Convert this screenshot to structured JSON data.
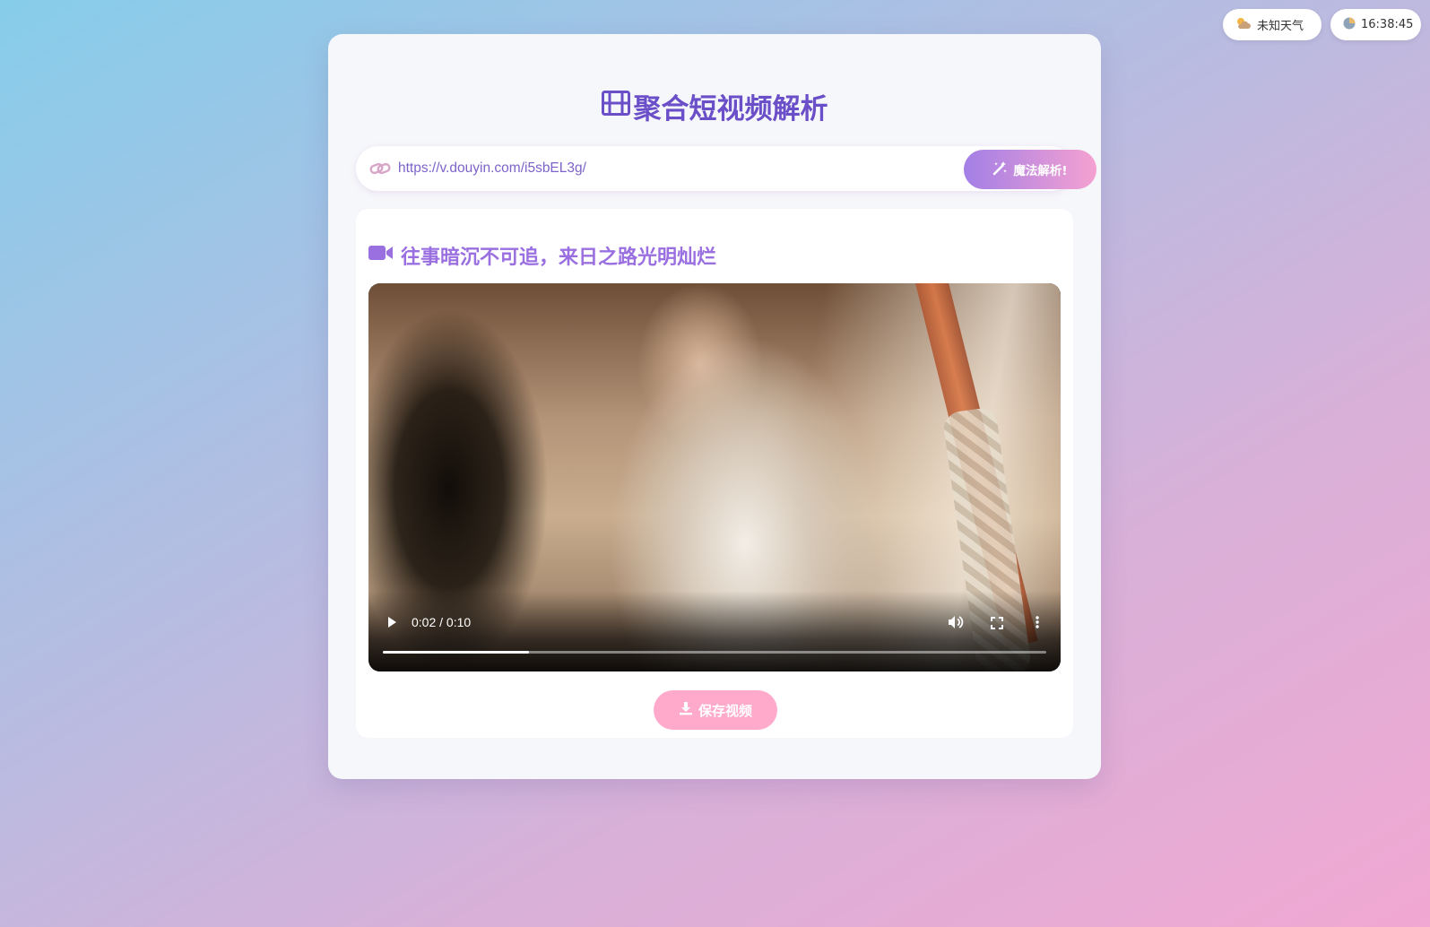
{
  "status": {
    "weather_icon": "partly-cloudy-icon",
    "weather_label": "未知天气",
    "clock_icon": "clock-icon",
    "time": "16:38:45"
  },
  "header": {
    "title_icon": "film-icon",
    "title": "聚合短视频解析"
  },
  "search": {
    "icon": "link-icon",
    "value": "https://v.douyin.com/i5sbEL3g/",
    "button_label": "魔法解析!"
  },
  "result": {
    "title_icon": "video-camera-icon",
    "title": "往事暗沉不可追，来日之路光明灿烂",
    "player": {
      "current_time": "0:02",
      "duration": "0:10",
      "time_display": "0:02 / 0:10",
      "progress": 0.22
    },
    "save_label": "保存视频"
  },
  "colors": {
    "accent": "#6a4fc8",
    "title_purple": "#9a6fe0",
    "save_pink": "#ffa9cb"
  }
}
